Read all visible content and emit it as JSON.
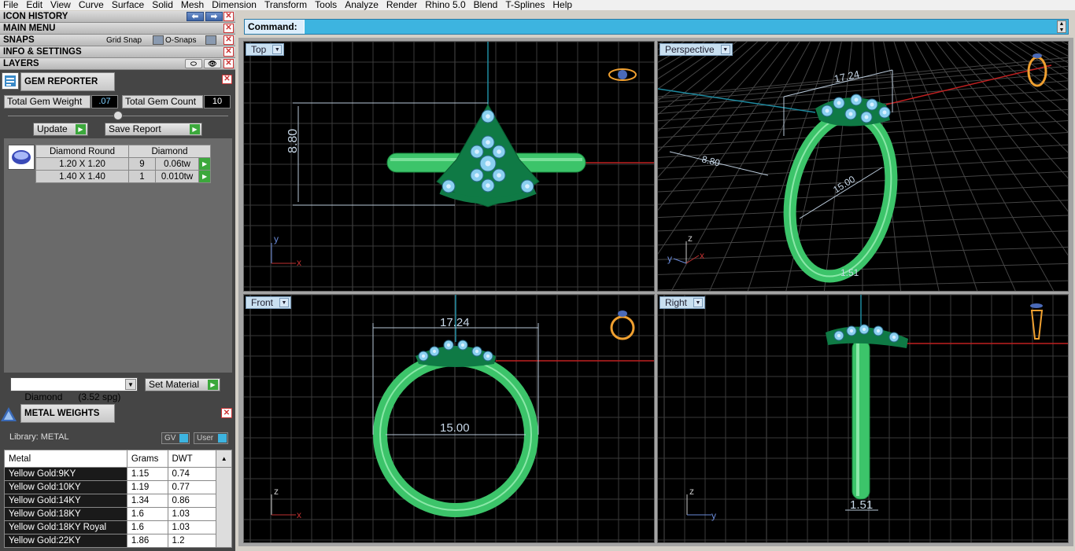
{
  "menu": [
    "File",
    "Edit",
    "View",
    "Curve",
    "Surface",
    "Solid",
    "Mesh",
    "Dimension",
    "Transform",
    "Tools",
    "Analyze",
    "Render",
    "Rhino 5.0",
    "Blend",
    "T-Splines",
    "Help"
  ],
  "panels": {
    "icon_history": "ICON HISTORY",
    "main_menu": "MAIN MENU",
    "snaps": "SNAPS",
    "grid_snap": "Grid Snap",
    "o_snaps": "O-Snaps",
    "info": "INFO & SETTINGS",
    "layers": "LAYERS",
    "close_glyph": "✕"
  },
  "gem": {
    "title": "GEM REPORTER",
    "weight_label": "Total Gem Weight",
    "weight_value": ".07",
    "count_label": "Total Gem Count",
    "count_value": "10",
    "update_label": "Update",
    "save_label": "Save Report",
    "table_header": [
      "Diamond Round",
      "Diamond"
    ],
    "rows": [
      {
        "size": "1.20 X 1.20",
        "count": "9",
        "weight": "0.06tw"
      },
      {
        "size": "1.40 X 1.40",
        "count": "1",
        "weight": "0.010tw"
      }
    ],
    "material_select": "Diamond      (3.52 spg)",
    "set_material": "Set Material"
  },
  "metal": {
    "title": "METAL WEIGHTS",
    "library": "Library: METAL",
    "gv": "GV",
    "user": "User",
    "headers": [
      "Metal",
      "Grams",
      "DWT"
    ],
    "rows": [
      [
        "Yellow Gold:9KY",
        "1.15",
        "0.74"
      ],
      [
        "Yellow Gold:10KY",
        "1.19",
        "0.77"
      ],
      [
        "Yellow Gold:14KY",
        "1.34",
        "0.86"
      ],
      [
        "Yellow Gold:18KY",
        "1.6",
        "1.03"
      ],
      [
        "Yellow Gold:18KY Royal",
        "1.6",
        "1.03"
      ],
      [
        "Yellow Gold:22KY",
        "1.86",
        "1.2"
      ]
    ]
  },
  "command": {
    "label": "Command:"
  },
  "viewports": {
    "top": "Top",
    "perspective": "Perspective",
    "front": "Front",
    "right": "Right"
  },
  "dims": {
    "height": "8.80",
    "width": "17.24",
    "inner": "15.00",
    "thick": "1.51",
    "persp_w": "17.24",
    "persp_h": "8.80",
    "persp_in": "15.00",
    "persp_t": "1.51"
  },
  "axes": {
    "x": "x",
    "y": "y",
    "z": "z"
  },
  "colors": {
    "ring": "#3cc46a",
    "gem": "#8ad0f0",
    "dark": "#0f7a45",
    "grid": "#3a3a3a",
    "cmd": "#3db4e0"
  }
}
